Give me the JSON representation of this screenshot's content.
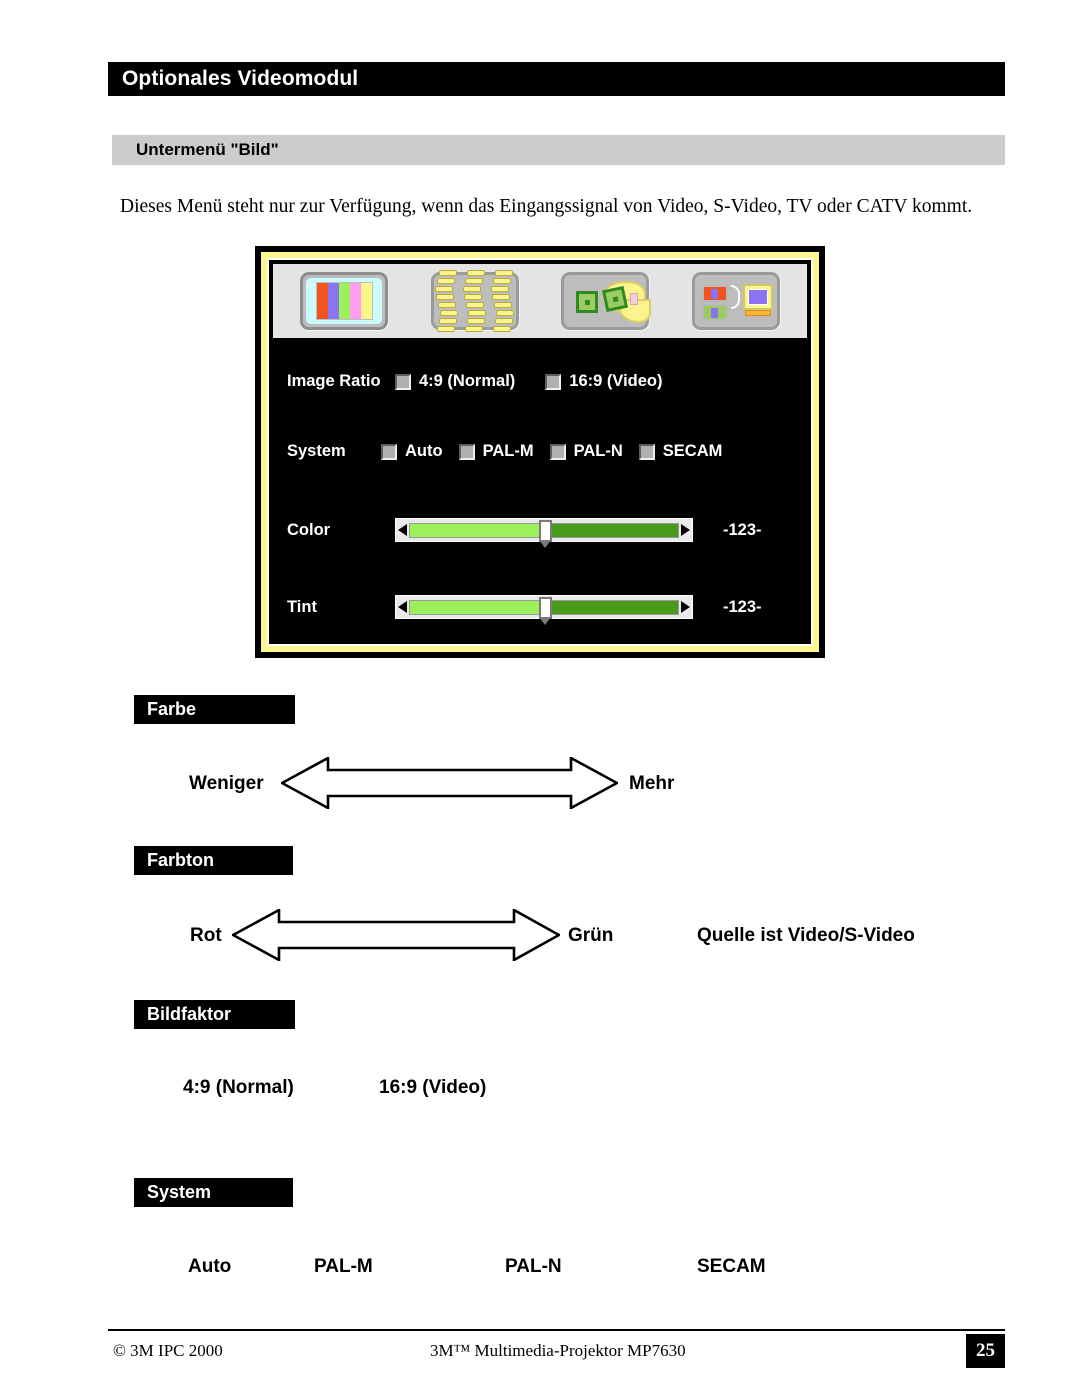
{
  "page": {
    "title": "Optionales Videomodul",
    "subheading": "Untermenü \"Bild\"",
    "paragraph": "Dieses Menü steht nur zur Verfügung, wenn das Eingangssignal von Video, S-Video, TV oder CATV kommt."
  },
  "osd": {
    "icons": [
      {
        "name": "color-bars-icon",
        "selected": true
      },
      {
        "name": "wavy-lines-icon",
        "selected": false
      },
      {
        "name": "hand-squares-icon",
        "selected": false
      },
      {
        "name": "source-monitor-icon",
        "selected": false
      }
    ],
    "rows": {
      "image_ratio": {
        "label": "Image Ratio",
        "options": [
          "4:9 (Normal)",
          "16:9 (Video)"
        ]
      },
      "system": {
        "label": "System",
        "options": [
          "Auto",
          "PAL-M",
          "PAL-N",
          "SECAM"
        ]
      },
      "color": {
        "label": "Color",
        "value": "-123-",
        "fill_percent": 50
      },
      "tint": {
        "label": "Tint",
        "value": "-123-",
        "fill_percent": 50
      }
    }
  },
  "sections": [
    {
      "heading": "Farbe",
      "left_label": "Weniger",
      "right_label": "Mehr"
    },
    {
      "heading": "Farbton",
      "left_label": "Rot",
      "right_label": "Grün",
      "note": "Quelle ist Video/S-Video"
    },
    {
      "heading": "Bildfaktor",
      "options": [
        "4:9 (Normal)",
        "16:9 (Video)"
      ]
    },
    {
      "heading": "System",
      "options": [
        "Auto",
        "PAL-M",
        "PAL-N",
        "SECAM"
      ]
    }
  ],
  "footer": {
    "copyright": "© 3M IPC 2000",
    "center": "3M™ Multimedia-Projektor MP7630",
    "page_number": "25"
  },
  "colors": {
    "accent_yellow": "#fbf58d",
    "slider_fill_light": "#9cf05a",
    "slider_fill_dark": "#479b18",
    "bar_black": "#000000",
    "subhead_gray": "#cccccc"
  }
}
